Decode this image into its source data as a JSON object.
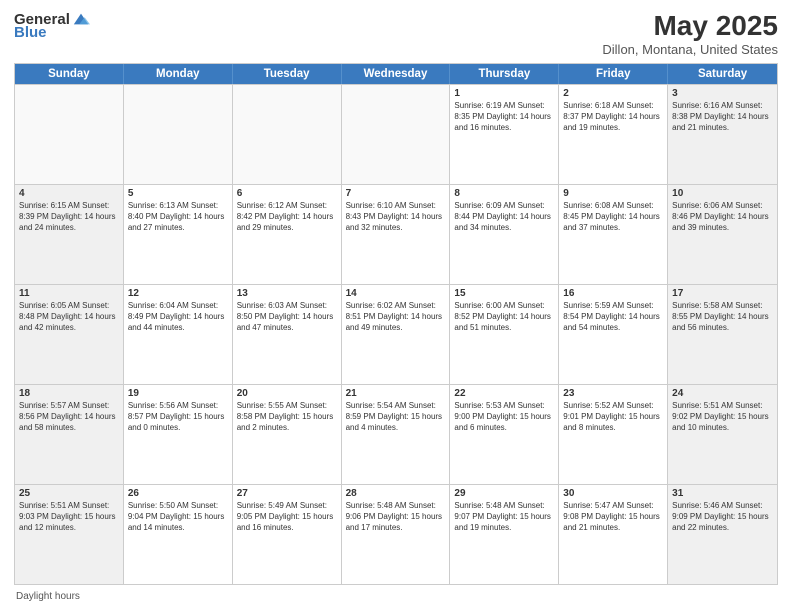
{
  "header": {
    "logo_general": "General",
    "logo_blue": "Blue",
    "title": "May 2025",
    "subtitle": "Dillon, Montana, United States"
  },
  "days": [
    "Sunday",
    "Monday",
    "Tuesday",
    "Wednesday",
    "Thursday",
    "Friday",
    "Saturday"
  ],
  "weeks": [
    [
      {
        "num": "",
        "text": "",
        "empty": true
      },
      {
        "num": "",
        "text": "",
        "empty": true
      },
      {
        "num": "",
        "text": "",
        "empty": true
      },
      {
        "num": "",
        "text": "",
        "empty": true
      },
      {
        "num": "1",
        "text": "Sunrise: 6:19 AM\nSunset: 8:35 PM\nDaylight: 14 hours\nand 16 minutes.",
        "empty": false
      },
      {
        "num": "2",
        "text": "Sunrise: 6:18 AM\nSunset: 8:37 PM\nDaylight: 14 hours\nand 19 minutes.",
        "empty": false
      },
      {
        "num": "3",
        "text": "Sunrise: 6:16 AM\nSunset: 8:38 PM\nDaylight: 14 hours\nand 21 minutes.",
        "empty": false,
        "shaded": true
      }
    ],
    [
      {
        "num": "4",
        "text": "Sunrise: 6:15 AM\nSunset: 8:39 PM\nDaylight: 14 hours\nand 24 minutes.",
        "empty": false,
        "shaded": true
      },
      {
        "num": "5",
        "text": "Sunrise: 6:13 AM\nSunset: 8:40 PM\nDaylight: 14 hours\nand 27 minutes.",
        "empty": false
      },
      {
        "num": "6",
        "text": "Sunrise: 6:12 AM\nSunset: 8:42 PM\nDaylight: 14 hours\nand 29 minutes.",
        "empty": false
      },
      {
        "num": "7",
        "text": "Sunrise: 6:10 AM\nSunset: 8:43 PM\nDaylight: 14 hours\nand 32 minutes.",
        "empty": false
      },
      {
        "num": "8",
        "text": "Sunrise: 6:09 AM\nSunset: 8:44 PM\nDaylight: 14 hours\nand 34 minutes.",
        "empty": false
      },
      {
        "num": "9",
        "text": "Sunrise: 6:08 AM\nSunset: 8:45 PM\nDaylight: 14 hours\nand 37 minutes.",
        "empty": false
      },
      {
        "num": "10",
        "text": "Sunrise: 6:06 AM\nSunset: 8:46 PM\nDaylight: 14 hours\nand 39 minutes.",
        "empty": false,
        "shaded": true
      }
    ],
    [
      {
        "num": "11",
        "text": "Sunrise: 6:05 AM\nSunset: 8:48 PM\nDaylight: 14 hours\nand 42 minutes.",
        "empty": false,
        "shaded": true
      },
      {
        "num": "12",
        "text": "Sunrise: 6:04 AM\nSunset: 8:49 PM\nDaylight: 14 hours\nand 44 minutes.",
        "empty": false
      },
      {
        "num": "13",
        "text": "Sunrise: 6:03 AM\nSunset: 8:50 PM\nDaylight: 14 hours\nand 47 minutes.",
        "empty": false
      },
      {
        "num": "14",
        "text": "Sunrise: 6:02 AM\nSunset: 8:51 PM\nDaylight: 14 hours\nand 49 minutes.",
        "empty": false
      },
      {
        "num": "15",
        "text": "Sunrise: 6:00 AM\nSunset: 8:52 PM\nDaylight: 14 hours\nand 51 minutes.",
        "empty": false
      },
      {
        "num": "16",
        "text": "Sunrise: 5:59 AM\nSunset: 8:54 PM\nDaylight: 14 hours\nand 54 minutes.",
        "empty": false
      },
      {
        "num": "17",
        "text": "Sunrise: 5:58 AM\nSunset: 8:55 PM\nDaylight: 14 hours\nand 56 minutes.",
        "empty": false,
        "shaded": true
      }
    ],
    [
      {
        "num": "18",
        "text": "Sunrise: 5:57 AM\nSunset: 8:56 PM\nDaylight: 14 hours\nand 58 minutes.",
        "empty": false,
        "shaded": true
      },
      {
        "num": "19",
        "text": "Sunrise: 5:56 AM\nSunset: 8:57 PM\nDaylight: 15 hours\nand 0 minutes.",
        "empty": false
      },
      {
        "num": "20",
        "text": "Sunrise: 5:55 AM\nSunset: 8:58 PM\nDaylight: 15 hours\nand 2 minutes.",
        "empty": false
      },
      {
        "num": "21",
        "text": "Sunrise: 5:54 AM\nSunset: 8:59 PM\nDaylight: 15 hours\nand 4 minutes.",
        "empty": false
      },
      {
        "num": "22",
        "text": "Sunrise: 5:53 AM\nSunset: 9:00 PM\nDaylight: 15 hours\nand 6 minutes.",
        "empty": false
      },
      {
        "num": "23",
        "text": "Sunrise: 5:52 AM\nSunset: 9:01 PM\nDaylight: 15 hours\nand 8 minutes.",
        "empty": false
      },
      {
        "num": "24",
        "text": "Sunrise: 5:51 AM\nSunset: 9:02 PM\nDaylight: 15 hours\nand 10 minutes.",
        "empty": false,
        "shaded": true
      }
    ],
    [
      {
        "num": "25",
        "text": "Sunrise: 5:51 AM\nSunset: 9:03 PM\nDaylight: 15 hours\nand 12 minutes.",
        "empty": false,
        "shaded": true
      },
      {
        "num": "26",
        "text": "Sunrise: 5:50 AM\nSunset: 9:04 PM\nDaylight: 15 hours\nand 14 minutes.",
        "empty": false
      },
      {
        "num": "27",
        "text": "Sunrise: 5:49 AM\nSunset: 9:05 PM\nDaylight: 15 hours\nand 16 minutes.",
        "empty": false
      },
      {
        "num": "28",
        "text": "Sunrise: 5:48 AM\nSunset: 9:06 PM\nDaylight: 15 hours\nand 17 minutes.",
        "empty": false
      },
      {
        "num": "29",
        "text": "Sunrise: 5:48 AM\nSunset: 9:07 PM\nDaylight: 15 hours\nand 19 minutes.",
        "empty": false
      },
      {
        "num": "30",
        "text": "Sunrise: 5:47 AM\nSunset: 9:08 PM\nDaylight: 15 hours\nand 21 minutes.",
        "empty": false
      },
      {
        "num": "31",
        "text": "Sunrise: 5:46 AM\nSunset: 9:09 PM\nDaylight: 15 hours\nand 22 minutes.",
        "empty": false,
        "shaded": true
      }
    ]
  ],
  "footer": {
    "daylight_label": "Daylight hours"
  }
}
